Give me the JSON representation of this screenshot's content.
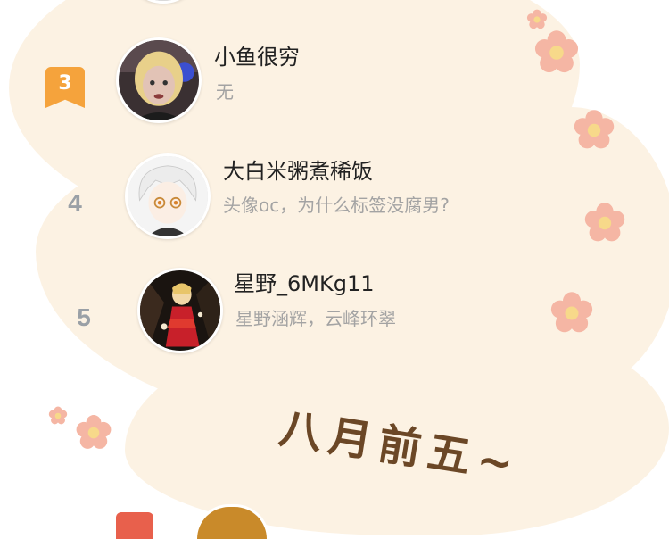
{
  "users": [
    {
      "rank": "3",
      "rank_style": "badge",
      "name": "小鱼很穷",
      "bio": "无",
      "avatar_icon": "avatar-blonde-portrait"
    },
    {
      "rank": "4",
      "rank_style": "plain",
      "name": "大白米粥煮稀饭",
      "bio": "头像oc，为什么标签没腐男?",
      "avatar_icon": "avatar-white-hair-anime"
    },
    {
      "rank": "5",
      "rank_style": "plain",
      "name": "星野_6MKg11",
      "bio": "星野涵辉，云峰环翠",
      "avatar_icon": "avatar-red-dress-anime"
    }
  ],
  "caption": {
    "text": "八月前五~"
  },
  "colors": {
    "background": "#fcf2e3",
    "flower": "#f5b6a4",
    "flower_center": "#f7d98a",
    "rank_badge": "#f5a33c",
    "rank_plain": "#9aa0a6",
    "caption": "#6b4726",
    "name": "#222222",
    "bio": "#a3a3a3"
  }
}
